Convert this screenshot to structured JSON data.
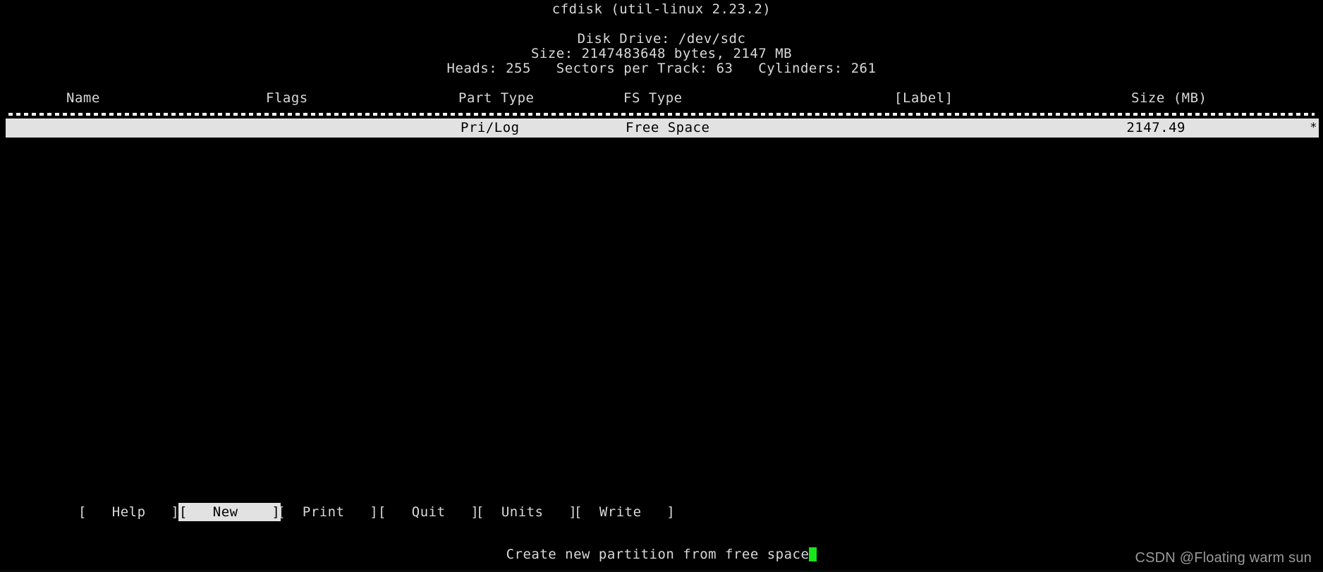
{
  "app": {
    "title": "cfdisk (util-linux 2.23.2)"
  },
  "disk": {
    "drive_line": "Disk Drive: /dev/sdc",
    "size_line": "Size: 2147483648 bytes, 2147 MB",
    "geometry_line": "Heads: 255   Sectors per Track: 63   Cylinders: 261",
    "heads": "255",
    "sectors_per_track": "63",
    "cylinders": "261",
    "size_bytes": "2147483648",
    "size_mb": "2147"
  },
  "table": {
    "columns": [
      {
        "key": "name",
        "label": "Name"
      },
      {
        "key": "flags",
        "label": "Flags"
      },
      {
        "key": "part_type",
        "label": "Part Type"
      },
      {
        "key": "fs_type",
        "label": "FS Type"
      },
      {
        "key": "label",
        "label": "[Label]"
      },
      {
        "key": "size_mb",
        "label": "Size (MB)"
      }
    ],
    "rows": [
      {
        "name": "",
        "flags": "",
        "part_type": "Pri/Log",
        "fs_type": "Free Space",
        "label": "",
        "size_mb": "2147.49",
        "marker": "*",
        "selected": true
      }
    ]
  },
  "buttons": [
    {
      "key": "help",
      "label": "[   Help   ]",
      "active": false
    },
    {
      "key": "new",
      "label": "[   New    ]",
      "active": true
    },
    {
      "key": "print",
      "label": "[  Print   ]",
      "active": false
    },
    {
      "key": "quit",
      "label": "[   Quit   ]",
      "active": false
    },
    {
      "key": "units",
      "label": "[  Units   ]",
      "active": false
    },
    {
      "key": "write",
      "label": "[  Write   ]",
      "active": false
    }
  ],
  "status": {
    "hint": "Create new partition from free space",
    "cursor_color": "#19e619"
  },
  "watermark": {
    "text": "CSDN @Floating warm sun"
  },
  "colors": {
    "background": "#000000",
    "foreground": "#d9d9d9",
    "highlight_bg": "#e2e2e2",
    "highlight_fg": "#000000",
    "cursor": "#19e619",
    "watermark": "#9a9a9a"
  }
}
